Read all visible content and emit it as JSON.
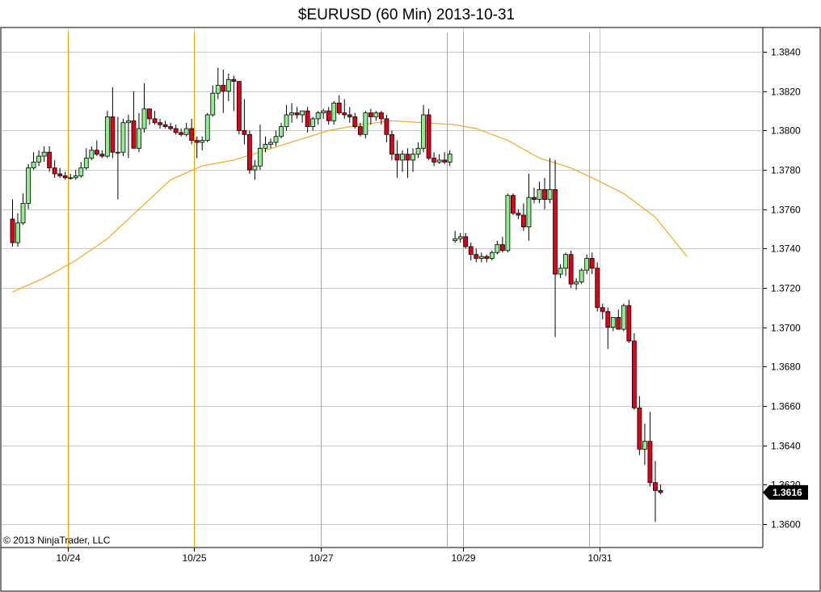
{
  "chart_data": {
    "type": "candlestick",
    "title": "$EURUSD (60 Min)  2013-10-31",
    "copyright": "© 2013 NinjaTrader, LLC",
    "last_price_label": "1.3616",
    "y_ticks": [
      "1.3600",
      "1.3620",
      "1.3640",
      "1.3660",
      "1.3680",
      "1.3700",
      "1.3720",
      "1.3740",
      "1.3760",
      "1.3780",
      "1.3800",
      "1.3820",
      "1.3840"
    ],
    "ylim": [
      1.3588,
      1.3852
    ],
    "x_ticks": [
      {
        "label": "10/24",
        "bar": 10.5
      },
      {
        "label": "10/25",
        "bar": 34.5
      },
      {
        "label": "10/27",
        "bar": 58.5
      },
      {
        "label": "10/29",
        "bar": 85.5
      },
      {
        "label": "10/31",
        "bar": 111.5
      }
    ],
    "session_lines": [
      10.5,
      34.5,
      58.5,
      82.5,
      85.5,
      109.5
    ],
    "grid": true,
    "colors": {
      "up": "#90ee90",
      "down": "#e0001a",
      "sma": "#f5a623",
      "session": "#f0a000",
      "grid": "#c8c8c8"
    },
    "indicator": "SMA",
    "bars": [
      [
        1.3755,
        1.3765,
        1.3741,
        1.3743
      ],
      [
        1.3743,
        1.3758,
        1.3741,
        1.3753
      ],
      [
        1.3753,
        1.3768,
        1.3752,
        1.3763
      ],
      [
        1.3763,
        1.3783,
        1.376,
        1.3781
      ],
      [
        1.3781,
        1.3789,
        1.378,
        1.3784
      ],
      [
        1.3784,
        1.379,
        1.3782,
        1.3787
      ],
      [
        1.3787,
        1.3792,
        1.3784,
        1.3789
      ],
      [
        1.3789,
        1.3792,
        1.3779,
        1.3781
      ],
      [
        1.3781,
        1.3785,
        1.3776,
        1.3778
      ],
      [
        1.3778,
        1.3781,
        1.3776,
        1.3777
      ],
      [
        1.3777,
        1.3779,
        1.3775,
        1.3776
      ],
      [
        1.3776,
        1.3778,
        1.3775,
        1.3776
      ],
      [
        1.3776,
        1.378,
        1.3775,
        1.3777
      ],
      [
        1.3777,
        1.3784,
        1.3776,
        1.3781
      ],
      [
        1.3781,
        1.3791,
        1.378,
        1.3786
      ],
      [
        1.3786,
        1.3792,
        1.3785,
        1.379
      ],
      [
        1.379,
        1.3795,
        1.3787,
        1.3788
      ],
      [
        1.3788,
        1.379,
        1.3786,
        1.3787
      ],
      [
        1.3787,
        1.381,
        1.3786,
        1.3807
      ],
      [
        1.3807,
        1.3822,
        1.3786,
        1.3789
      ],
      [
        1.3789,
        1.3807,
        1.3765,
        1.3789
      ],
      [
        1.3789,
        1.3806,
        1.3787,
        1.3804
      ],
      [
        1.3804,
        1.3808,
        1.3786,
        1.3805
      ],
      [
        1.3805,
        1.382,
        1.3796,
        1.3791
      ],
      [
        1.3791,
        1.3809,
        1.3789,
        1.3801
      ],
      [
        1.3801,
        1.3824,
        1.3799,
        1.3811
      ],
      [
        1.3811,
        1.3811,
        1.3803,
        1.3806
      ],
      [
        1.3806,
        1.381,
        1.3803,
        1.3804
      ],
      [
        1.3804,
        1.3806,
        1.3801,
        1.3803
      ],
      [
        1.3803,
        1.3805,
        1.3801,
        1.3802
      ],
      [
        1.3802,
        1.3804,
        1.38,
        1.3801
      ],
      [
        1.3801,
        1.3803,
        1.3798,
        1.3799
      ],
      [
        1.3799,
        1.3801,
        1.3797,
        1.3798
      ],
      [
        1.3798,
        1.3804,
        1.3797,
        1.3801
      ],
      [
        1.3801,
        1.3806,
        1.3793,
        1.3795
      ],
      [
        1.3795,
        1.3797,
        1.3786,
        1.3794
      ],
      [
        1.3794,
        1.3797,
        1.379,
        1.3795
      ],
      [
        1.3795,
        1.3809,
        1.3794,
        1.3808
      ],
      [
        1.3808,
        1.3823,
        1.3807,
        1.3819
      ],
      [
        1.3819,
        1.3832,
        1.3816,
        1.3823
      ],
      [
        1.3823,
        1.3831,
        1.3809,
        1.382
      ],
      [
        1.382,
        1.3829,
        1.3815,
        1.3826
      ],
      [
        1.3826,
        1.3828,
        1.381,
        1.3825
      ],
      [
        1.3825,
        1.3825,
        1.3798,
        1.38
      ],
      [
        1.38,
        1.3816,
        1.3793,
        1.3798
      ],
      [
        1.3798,
        1.38,
        1.3778,
        1.378
      ],
      [
        1.378,
        1.3785,
        1.3775,
        1.3782
      ],
      [
        1.3782,
        1.3803,
        1.378,
        1.3791
      ],
      [
        1.3791,
        1.3797,
        1.3789,
        1.3793
      ],
      [
        1.3793,
        1.3796,
        1.3791,
        1.3794
      ],
      [
        1.3794,
        1.38,
        1.3792,
        1.3797
      ],
      [
        1.3797,
        1.3804,
        1.3796,
        1.3802
      ],
      [
        1.3802,
        1.3813,
        1.38,
        1.3808
      ],
      [
        1.3808,
        1.3814,
        1.3804,
        1.3809
      ],
      [
        1.3809,
        1.3812,
        1.3806,
        1.3808
      ],
      [
        1.3808,
        1.381,
        1.3804,
        1.381
      ],
      [
        1.381,
        1.3812,
        1.3799,
        1.3802
      ],
      [
        1.3802,
        1.3807,
        1.38,
        1.3806
      ],
      [
        1.3806,
        1.381,
        1.3803,
        1.3809
      ],
      [
        1.3809,
        1.3811,
        1.3806,
        1.381
      ],
      [
        1.381,
        1.3812,
        1.3803,
        1.3805
      ],
      [
        1.3805,
        1.3815,
        1.3803,
        1.3814
      ],
      [
        1.3814,
        1.3818,
        1.3808,
        1.3809
      ],
      [
        1.3809,
        1.3816,
        1.3806,
        1.3808
      ],
      [
        1.3808,
        1.3812,
        1.3804,
        1.3807
      ],
      [
        1.3807,
        1.3809,
        1.3801,
        1.3802
      ],
      [
        1.3802,
        1.3804,
        1.3797,
        1.3798
      ],
      [
        1.3798,
        1.381,
        1.3796,
        1.3809
      ],
      [
        1.3809,
        1.3811,
        1.3803,
        1.3807
      ],
      [
        1.3807,
        1.381,
        1.3805,
        1.3809
      ],
      [
        1.3809,
        1.381,
        1.3803,
        1.3806
      ],
      [
        1.3806,
        1.3808,
        1.3794,
        1.3798
      ],
      [
        1.3798,
        1.38,
        1.3785,
        1.3788
      ],
      [
        1.3788,
        1.3795,
        1.3776,
        1.3785
      ],
      [
        1.3785,
        1.379,
        1.3779,
        1.3788
      ],
      [
        1.3788,
        1.3791,
        1.3776,
        1.3785
      ],
      [
        1.3785,
        1.3791,
        1.3779,
        1.3788
      ],
      [
        1.3788,
        1.3794,
        1.3786,
        1.3791
      ],
      [
        1.3791,
        1.3813,
        1.3789,
        1.3808
      ],
      [
        1.3808,
        1.3811,
        1.3785,
        1.3786
      ],
      [
        1.3786,
        1.3789,
        1.3782,
        1.3784
      ],
      [
        1.3784,
        1.3788,
        1.3783,
        1.3785
      ],
      [
        1.3785,
        1.3789,
        1.3783,
        1.3784
      ],
      [
        1.3784,
        1.379,
        1.3782,
        1.3788
      ],
      [
        1.3744,
        1.3749,
        1.3743,
        1.3745
      ],
      [
        1.3745,
        1.3748,
        1.3743,
        1.3746
      ],
      [
        1.3746,
        1.3748,
        1.374,
        1.3741
      ],
      [
        1.3741,
        1.3743,
        1.3734,
        1.3737
      ],
      [
        1.3737,
        1.374,
        1.3733,
        1.3735
      ],
      [
        1.3735,
        1.3738,
        1.3733,
        1.3736
      ],
      [
        1.3736,
        1.3737,
        1.3733,
        1.3735
      ],
      [
        1.3735,
        1.3739,
        1.3734,
        1.3738
      ],
      [
        1.3738,
        1.3744,
        1.3737,
        1.3742
      ],
      [
        1.3742,
        1.3746,
        1.3738,
        1.3739
      ],
      [
        1.3739,
        1.3768,
        1.3738,
        1.3767
      ],
      [
        1.3767,
        1.3768,
        1.3757,
        1.3758
      ],
      [
        1.3758,
        1.376,
        1.3755,
        1.3757
      ],
      [
        1.3757,
        1.3763,
        1.3749,
        1.3751
      ],
      [
        1.3751,
        1.3778,
        1.3744,
        1.3766
      ],
      [
        1.3766,
        1.3771,
        1.3763,
        1.3765
      ],
      [
        1.3765,
        1.3774,
        1.3763,
        1.377
      ],
      [
        1.377,
        1.3776,
        1.376,
        1.3765
      ],
      [
        1.3765,
        1.3786,
        1.3763,
        1.377
      ],
      [
        1.377,
        1.3785,
        1.3695,
        1.3727
      ],
      [
        1.3727,
        1.3732,
        1.3725,
        1.373
      ],
      [
        1.373,
        1.3738,
        1.3726,
        1.3737
      ],
      [
        1.3737,
        1.3739,
        1.372,
        1.3722
      ],
      [
        1.3722,
        1.3725,
        1.3719,
        1.3723
      ],
      [
        1.3723,
        1.373,
        1.3722,
        1.3729
      ],
      [
        1.3729,
        1.3737,
        1.3727,
        1.3735
      ],
      [
        1.3735,
        1.3738,
        1.3727,
        1.373
      ],
      [
        1.373,
        1.3733,
        1.3708,
        1.371
      ],
      [
        1.371,
        1.3712,
        1.3704,
        1.3708
      ],
      [
        1.3708,
        1.371,
        1.3689,
        1.37
      ],
      [
        1.37,
        1.3705,
        1.3698,
        1.3705
      ],
      [
        1.3705,
        1.3709,
        1.3699,
        1.3699
      ],
      [
        1.3699,
        1.3712,
        1.3698,
        1.3711
      ],
      [
        1.3711,
        1.3714,
        1.3692,
        1.3693
      ],
      [
        1.3693,
        1.3697,
        1.3658,
        1.3659
      ],
      [
        1.3659,
        1.3665,
        1.3635,
        1.3638
      ],
      [
        1.3638,
        1.3651,
        1.363,
        1.3642
      ],
      [
        1.3642,
        1.3657,
        1.3619,
        1.3621
      ],
      [
        1.3621,
        1.3632,
        1.3601,
        1.3617
      ],
      [
        1.3617,
        1.362,
        1.3615,
        1.3616
      ]
    ],
    "sma": [
      [
        0,
        1.3718
      ],
      [
        6,
        1.3725
      ],
      [
        12,
        1.3734
      ],
      [
        18,
        1.3745
      ],
      [
        24,
        1.376
      ],
      [
        30,
        1.3775
      ],
      [
        36,
        1.3782
      ],
      [
        42,
        1.3785
      ],
      [
        48,
        1.379
      ],
      [
        54,
        1.3795
      ],
      [
        60,
        1.38
      ],
      [
        66,
        1.3803
      ],
      [
        72,
        1.3805
      ],
      [
        78,
        1.3804
      ],
      [
        84,
        1.3803
      ],
      [
        88,
        1.3801
      ],
      [
        94,
        1.3795
      ],
      [
        100,
        1.3786
      ],
      [
        106,
        1.3781
      ],
      [
        110,
        1.3776
      ],
      [
        116,
        1.3768
      ],
      [
        122,
        1.3756
      ],
      [
        128,
        1.3736
      ]
    ]
  }
}
